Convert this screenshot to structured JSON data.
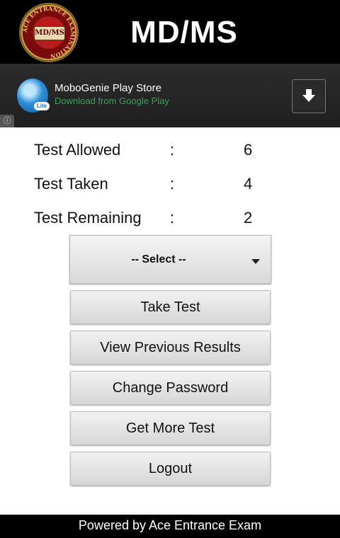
{
  "header": {
    "title": "MD/MS",
    "logo_center_text": "MD/MS",
    "logo_ring_text": "ACE ENTRANCE EXAMINATION"
  },
  "ad": {
    "title": "MoboGenie Play Store",
    "subtitle": "Download from Google Play",
    "icon_badge": "Lite",
    "info_icon": "info-icon",
    "download_icon": "download-arrow-icon"
  },
  "stats": [
    {
      "label": "Test Allowed",
      "colon": ":",
      "value": "6"
    },
    {
      "label": "Test Taken",
      "colon": ":",
      "value": "4"
    },
    {
      "label": "Test Remaining",
      "colon": ":",
      "value": "2"
    }
  ],
  "select": {
    "value": "-- Select --",
    "icon": "dropdown-caret-icon"
  },
  "buttons": {
    "take_test": "Take Test",
    "view_results": "View Previous Results",
    "change_password": "Change Password",
    "get_more_test": "Get More Test",
    "logout": "Logout"
  },
  "footer": {
    "text": "Powered by Ace Entrance Exam"
  },
  "colors": {
    "header_bg": "#000000",
    "ad_subtitle": "#3aa05a",
    "footer_bg": "#000000"
  }
}
